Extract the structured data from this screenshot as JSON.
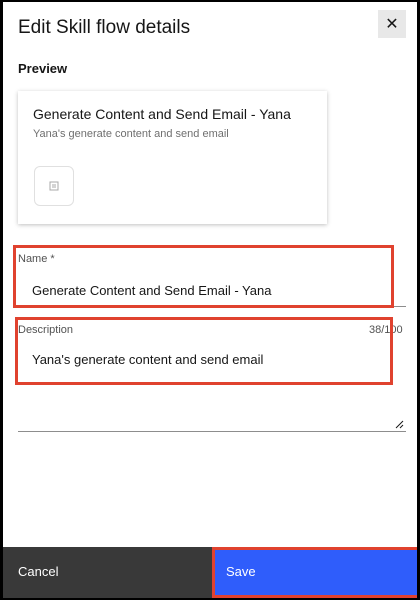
{
  "modal": {
    "title": "Edit Skill flow details",
    "close_glyph": "✕",
    "close_icon": "close-icon"
  },
  "preview": {
    "label": "Preview",
    "card_title": "Generate Content and Send Email - Yana",
    "card_description": "Yana's generate content and send email",
    "card_icon": "skill-flow-icon"
  },
  "form": {
    "name_label": "Name *",
    "name_value": "Generate Content and Send Email - Yana",
    "description_label": "Description",
    "description_value": "Yana's generate content and send email",
    "description_counter": "38/100"
  },
  "footer": {
    "cancel_label": "Cancel",
    "save_label": "Save"
  },
  "colors": {
    "primary": "#2f5dfb",
    "secondary": "#393939",
    "highlight": "#e0422f"
  }
}
